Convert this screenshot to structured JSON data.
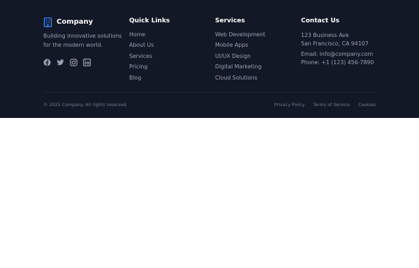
{
  "brand": {
    "name": "Company",
    "tagline_line1": "Building innovative solutions",
    "tagline_line2": "for the modern world.",
    "icon": "building-icon",
    "accent_color": "#3b82f6"
  },
  "socials": [
    {
      "icon": "facebook-icon"
    },
    {
      "icon": "twitter-icon"
    },
    {
      "icon": "instagram-icon"
    },
    {
      "icon": "linkedin-icon"
    }
  ],
  "quick_links": {
    "title": "Quick Links",
    "items": [
      "Home",
      "About Us",
      "Services",
      "Pricing",
      "Blog"
    ]
  },
  "services": {
    "title": "Services",
    "items": [
      "Web Development",
      "Mobile Apps",
      "UI/UX Design",
      "Digital Marketing",
      "Cloud Solutions"
    ]
  },
  "contact": {
    "title": "Contact Us",
    "address_line1": "123 Business Ave",
    "address_line2": "San Francisco, CA 94107",
    "email": "Email: info@company.com",
    "phone": "Phone: +1 (123) 456-7890"
  },
  "bottom": {
    "copyright": "© 2025 Company. All rights reserved.",
    "privacy": "Privacy Policy",
    "terms": "Terms of Service",
    "cookies": "Cookies"
  },
  "colors": {
    "footer_background": "#121826",
    "muted_text": "#9aa3b3",
    "heading_text": "#ffffff"
  }
}
